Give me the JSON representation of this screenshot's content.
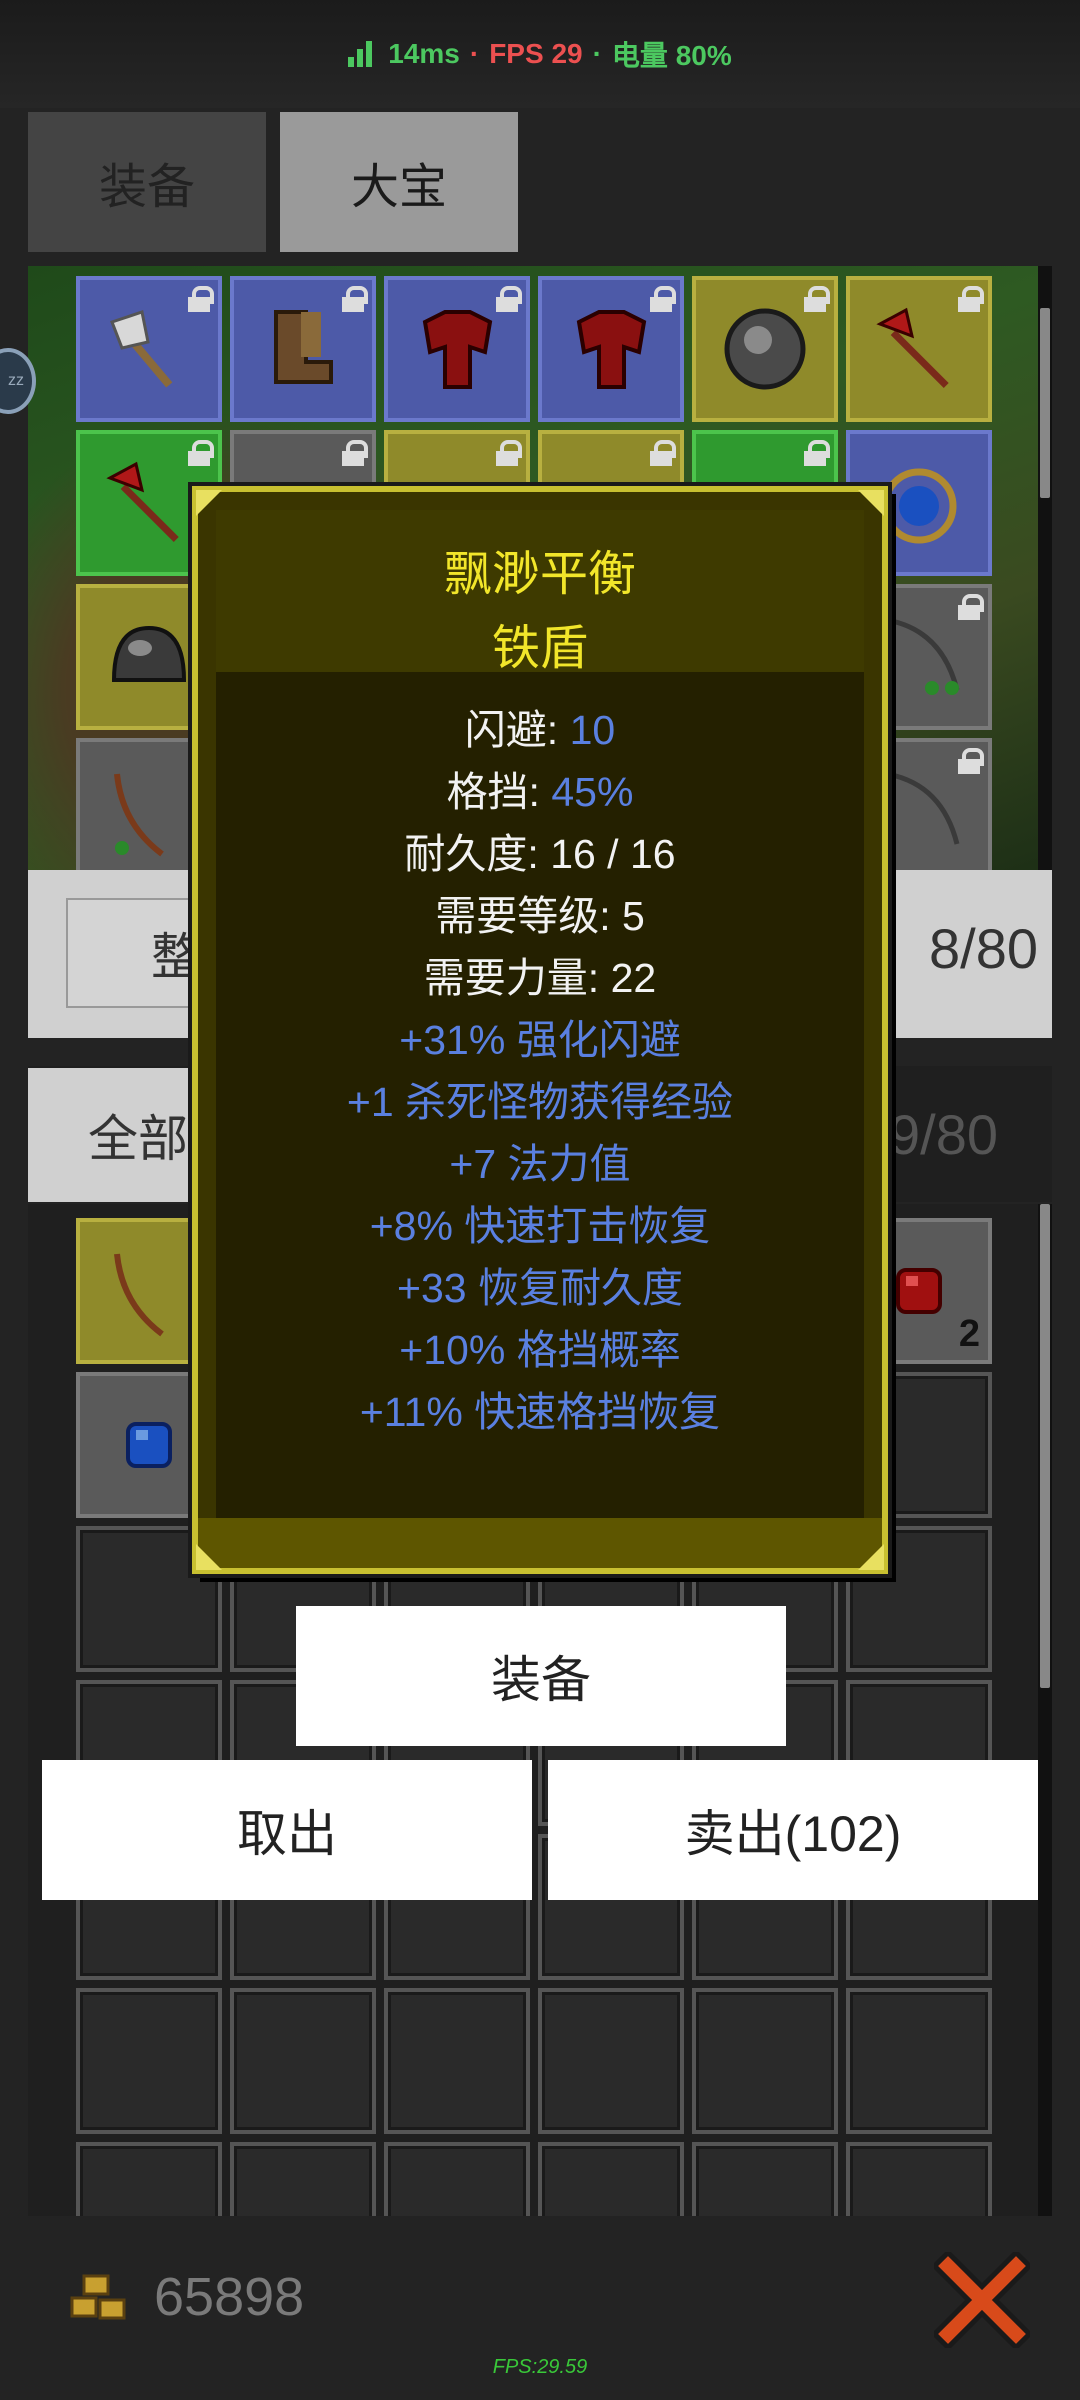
{
  "status_bar": {
    "ping": "14ms",
    "sep1": "·",
    "fps": "FPS 29",
    "sep2": "·",
    "battery": "电量 80%"
  },
  "tabs": [
    {
      "label": "装备",
      "selected": false
    },
    {
      "label": "大宝",
      "selected": true
    }
  ],
  "inventory": {
    "sort_label": "整",
    "storage_capacity": "8/80",
    "filter_label": "全部",
    "bag_capacity": "9/80",
    "stack_count": "2"
  },
  "tooltip": {
    "prefix": "飘渺平衡",
    "item_type": "铁盾",
    "stats": [
      {
        "label": "闪避: ",
        "value": "10"
      },
      {
        "label": "格挡: ",
        "value": "45%"
      },
      {
        "label": "耐久度: 16 / 16"
      },
      {
        "label": "需要等级: 5"
      },
      {
        "label": "需要力量: 22"
      }
    ],
    "affixes": [
      "+31% 强化闪避",
      "+1 杀死怪物获得经验",
      "+7 法力值",
      "+8% 快速打击恢复",
      "+33 恢复耐久度",
      "+10% 格挡概率",
      "+11% 快速格挡恢复"
    ]
  },
  "actions": {
    "equip": "装备",
    "take_out": "取出",
    "sell": "卖出(102)"
  },
  "footer": {
    "gold": "65898",
    "fps_debug": "FPS:29.59"
  },
  "colors": {
    "item_name": "#f2e62a",
    "magic_text": "#5a80e0",
    "fps_green": "#4cc860",
    "fps_red": "#ec5050"
  }
}
